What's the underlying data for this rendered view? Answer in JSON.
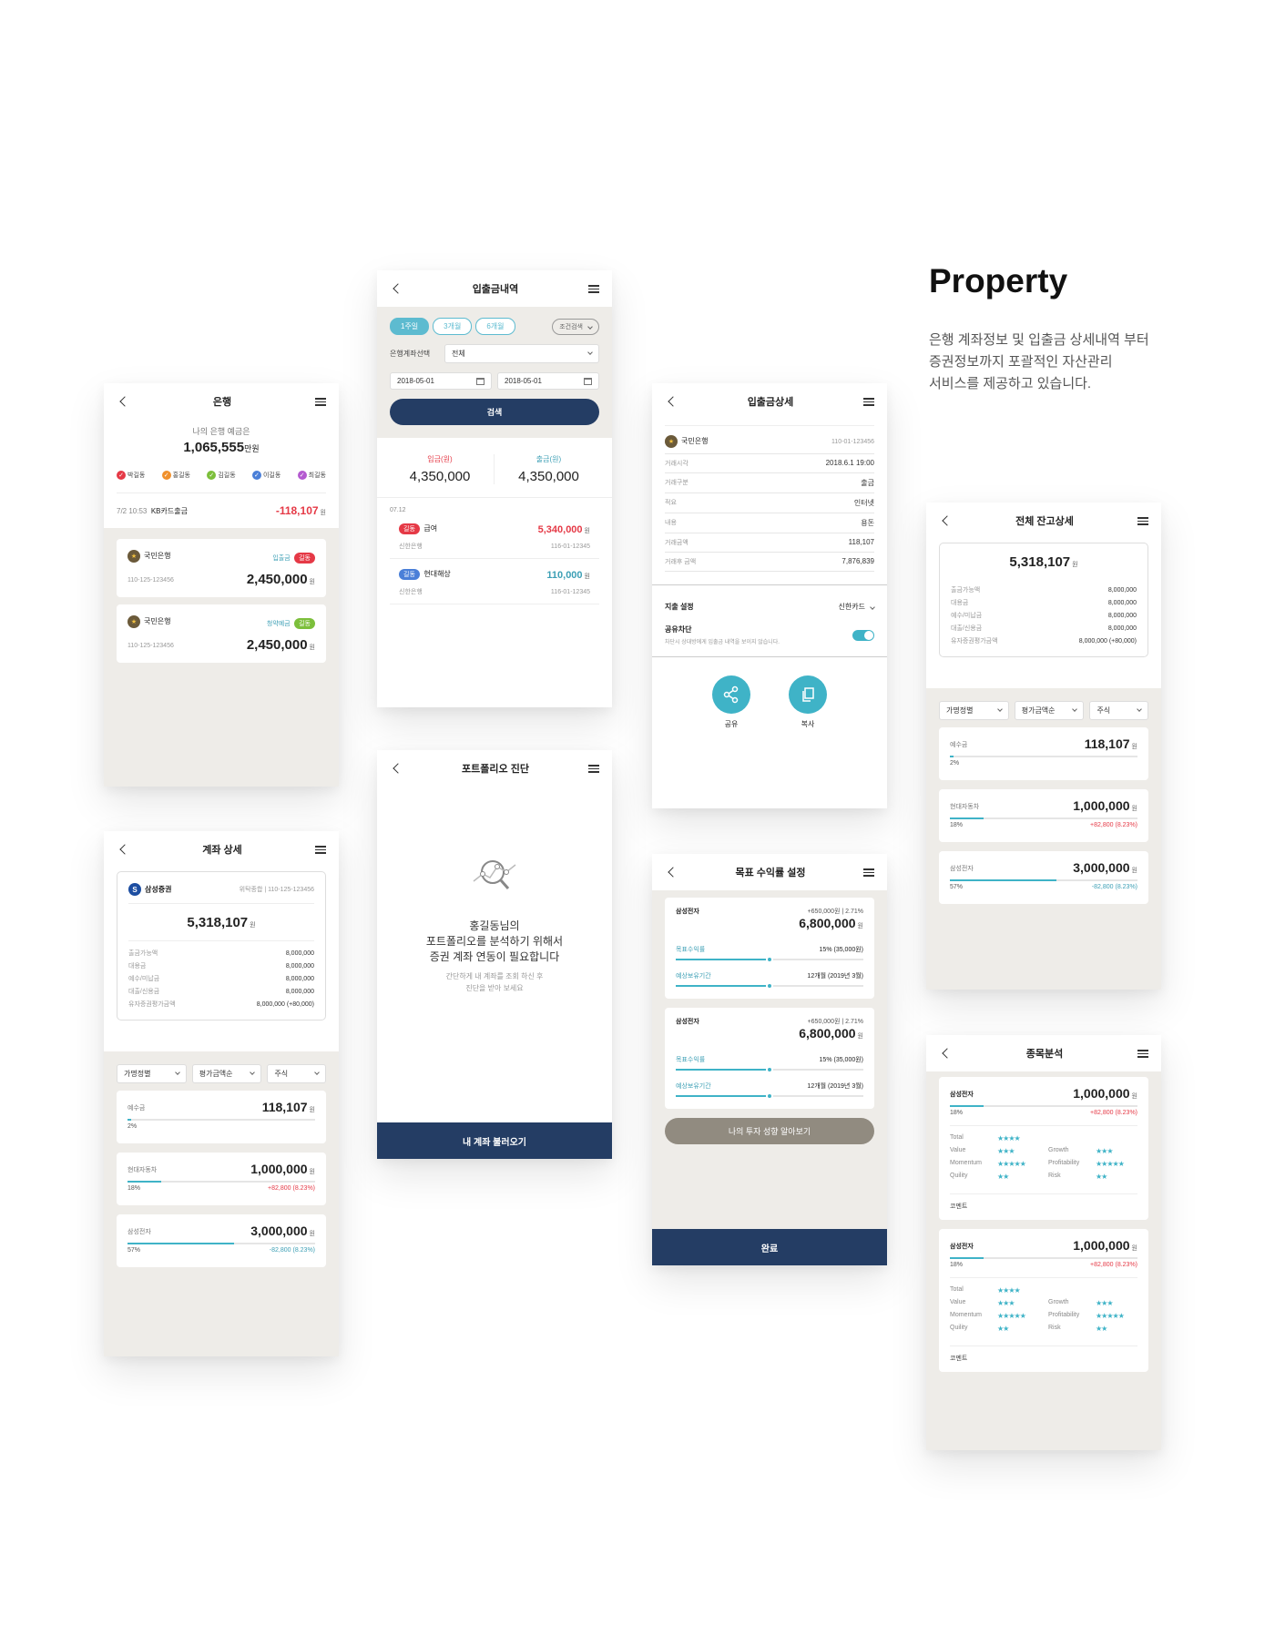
{
  "title": "Property",
  "description": [
    "은행 계좌정보 및 입출금 상세내역 부터",
    "증권정보까지 포괄적인 자산관리",
    "서비스를 제공하고 있습니다."
  ],
  "bank": {
    "title": "은행",
    "summary_label": "나의 은행 예금은",
    "summary_amount": "1,065,555",
    "summary_unit": "만원",
    "users": [
      {
        "name": "박길동",
        "color": "#e53946"
      },
      {
        "name": "홍길동",
        "color": "#f0902c"
      },
      {
        "name": "김길동",
        "color": "#7cbf3b"
      },
      {
        "name": "이길동",
        "color": "#4a7fd8"
      },
      {
        "name": "최길동",
        "color": "#b45ad0"
      }
    ],
    "recent_time": "7/2 10:53",
    "recent_desc": "KB카드출금",
    "recent_amount": "-118,107",
    "won": "원",
    "accounts": [
      {
        "bank": "국민은행",
        "type": "입출금",
        "owner": "길동",
        "owner_color": "#e53946",
        "number": "110-125-123456",
        "amount": "2,450,000"
      },
      {
        "bank": "국민은행",
        "type": "청약예금",
        "owner": "길동",
        "owner_color": "#7cbf3b",
        "number": "110-125-123456",
        "amount": "2,450,000"
      }
    ]
  },
  "history": {
    "title": "입출금내역",
    "periods": [
      "1주일",
      "3개월",
      "6개월"
    ],
    "condition": "조건검색",
    "account_label": "은행계좌선택",
    "account_value": "전체",
    "date_from": "2018-05-01",
    "date_to": "2018-05-01",
    "search": "검색",
    "in_label": "입금(원)",
    "out_label": "출금(원)",
    "in_amount": "4,350,000",
    "out_amount": "4,350,000",
    "date": "07.12",
    "items": [
      {
        "tag": "길동",
        "tag_color": "#e53946",
        "title": "급여",
        "amount": "5,340,000",
        "amount_color": "#e53946",
        "bank": "신한은행",
        "acct": "116-01-12345"
      },
      {
        "tag": "길동",
        "tag_color": "#4a7fd8",
        "title": "현대해상",
        "amount": "110,000",
        "amount_color": "#3c9fb5",
        "bank": "신한은행",
        "acct": "116-01-12345"
      }
    ]
  },
  "detail": {
    "title": "입출금상세",
    "bank": "국민은행",
    "acct": "110-01-123456",
    "rows": [
      {
        "k": "거래시각",
        "v": "2018.6.1 19:00"
      },
      {
        "k": "거래구분",
        "v": "출금"
      },
      {
        "k": "적요",
        "v": "인터넷"
      },
      {
        "k": "내용",
        "v": "용돈"
      },
      {
        "k": "거래금액",
        "v": "118,107"
      },
      {
        "k": "거래후 금액",
        "v": "7,876,839"
      }
    ],
    "expense_label": "지출 설정",
    "expense_value": "신한카드",
    "share_block_label": "공유차단",
    "share_block_desc": "차단시 상대방에게 입출금 내역을 보이지 않습니다.",
    "share_on": true,
    "share": "공유",
    "copy": "복사"
  },
  "balance": {
    "title": "전체 잔고상세",
    "total": "5,318,107",
    "rows": [
      {
        "k": "출금가능액",
        "v": "8,000,000"
      },
      {
        "k": "대용금",
        "v": "8,000,000"
      },
      {
        "k": "예수/미납금",
        "v": "8,000,000"
      },
      {
        "k": "대출/신용금",
        "v": "8,000,000"
      },
      {
        "k": "유자증권평가금액",
        "v": "8,000,000 (+80,000)"
      }
    ],
    "filters": [
      "가명정별",
      "평가금액순",
      "주식"
    ],
    "stocks": [
      {
        "name": "예수금",
        "amount": "118,107",
        "pct": "2%",
        "fill": 0.02,
        "change": "",
        "change_color": ""
      },
      {
        "name": "현대자동차",
        "amount": "1,000,000",
        "pct": "18%",
        "fill": 0.18,
        "change": "+82,800 (8.23%)",
        "change_color": "#e53946"
      },
      {
        "name": "삼성전자",
        "amount": "3,000,000",
        "pct": "57%",
        "fill": 0.57,
        "change": "-82,800 (8.23%)",
        "change_color": "#3c9fb5"
      }
    ]
  },
  "account": {
    "title": "계좌 상세",
    "broker": "삼성증권",
    "broker_type": "위탁종합",
    "acct": "110-125-123456",
    "total": "5,318,107",
    "rows": [
      {
        "k": "출금가능액",
        "v": "8,000,000"
      },
      {
        "k": "대용금",
        "v": "8,000,000"
      },
      {
        "k": "예수/미납금",
        "v": "8,000,000"
      },
      {
        "k": "대출/신용금",
        "v": "8,000,000"
      },
      {
        "k": "유자증권평가금액",
        "v": "8,000,000 (+80,000)"
      }
    ],
    "filters": [
      "가명정별",
      "평가금액순",
      "주식"
    ],
    "stocks": [
      {
        "name": "예수금",
        "amount": "118,107",
        "pct": "2%",
        "fill": 0.02,
        "change": "",
        "change_color": ""
      },
      {
        "name": "현대자동차",
        "amount": "1,000,000",
        "pct": "18%",
        "fill": 0.18,
        "change": "+82,800 (8.23%)",
        "change_color": "#e53946"
      },
      {
        "name": "삼성전자",
        "amount": "3,000,000",
        "pct": "57%",
        "fill": 0.57,
        "change": "-82,800 (8.23%)",
        "change_color": "#3c9fb5"
      }
    ]
  },
  "portfolio": {
    "title": "포트폴리오 진단",
    "msg1": "홍길동님의",
    "msg2": "포트폴리오를 분석하기 위해서",
    "msg3": "증권 계좌 연동이 필요합니다",
    "sub1": "간단하게 내 계좌를 조회 하신 후",
    "sub2": "진단을 받아 보세요",
    "button": "내 계좌 불러오기"
  },
  "target": {
    "title": "목표 수익률 설정",
    "cards": [
      {
        "name": "삼성전자",
        "gain": "+650,000원",
        "rate": "2.71%",
        "amount": "6,800,000",
        "goal_label": "목표수익률",
        "goal_value": "15% (35,000원)",
        "goal_fill": 0.5,
        "period_label": "예상보유기간",
        "period_value": "12개월 (2019년 3월)",
        "period_fill": 0.5
      },
      {
        "name": "삼성전자",
        "gain": "+650,000원",
        "rate": "2.71%",
        "amount": "6,800,000",
        "goal_label": "목표수익률",
        "goal_value": "15% (35,000원)",
        "goal_fill": 0.5,
        "period_label": "예상보유기간",
        "period_value": "12개월 (2019년 3월)",
        "period_fill": 0.5
      }
    ],
    "style_button": "나의 투자 성향 알아보기",
    "done": "완료"
  },
  "analysis": {
    "title": "종목분석",
    "cards": [
      {
        "name": "삼성전자",
        "amount": "1,000,000",
        "pct": "18%",
        "fill": 0.18,
        "change": "+82,800 (8.23%)",
        "total": "Total",
        "total_stars": "★★★★",
        "value": "Value",
        "value_stars": "★★★",
        "growth": "Growth",
        "growth_stars": "★★★",
        "momentum": "Momentum",
        "momentum_stars": "★★★★★",
        "profit": "Profitability",
        "profit_stars": "★★★★★",
        "quality": "Quility",
        "quality_stars": "★★",
        "risk": "Risk",
        "risk_stars": "★★",
        "comment": "코멘트"
      },
      {
        "name": "삼성전자",
        "amount": "1,000,000",
        "pct": "18%",
        "fill": 0.18,
        "change": "+82,800 (8.23%)",
        "total": "Total",
        "total_stars": "★★★★",
        "value": "Value",
        "value_stars": "★★★",
        "growth": "Growth",
        "growth_stars": "★★★",
        "momentum": "Momentum",
        "momentum_stars": "★★★★★",
        "profit": "Profitability",
        "profit_stars": "★★★★★",
        "quality": "Quility",
        "quality_stars": "★★",
        "risk": "Risk",
        "risk_stars": "★★",
        "comment": "코멘트"
      }
    ]
  },
  "colors": {
    "navy": "#243d64",
    "teal": "#3fb3c7",
    "red": "#e53946",
    "bg": "#eeece8"
  }
}
